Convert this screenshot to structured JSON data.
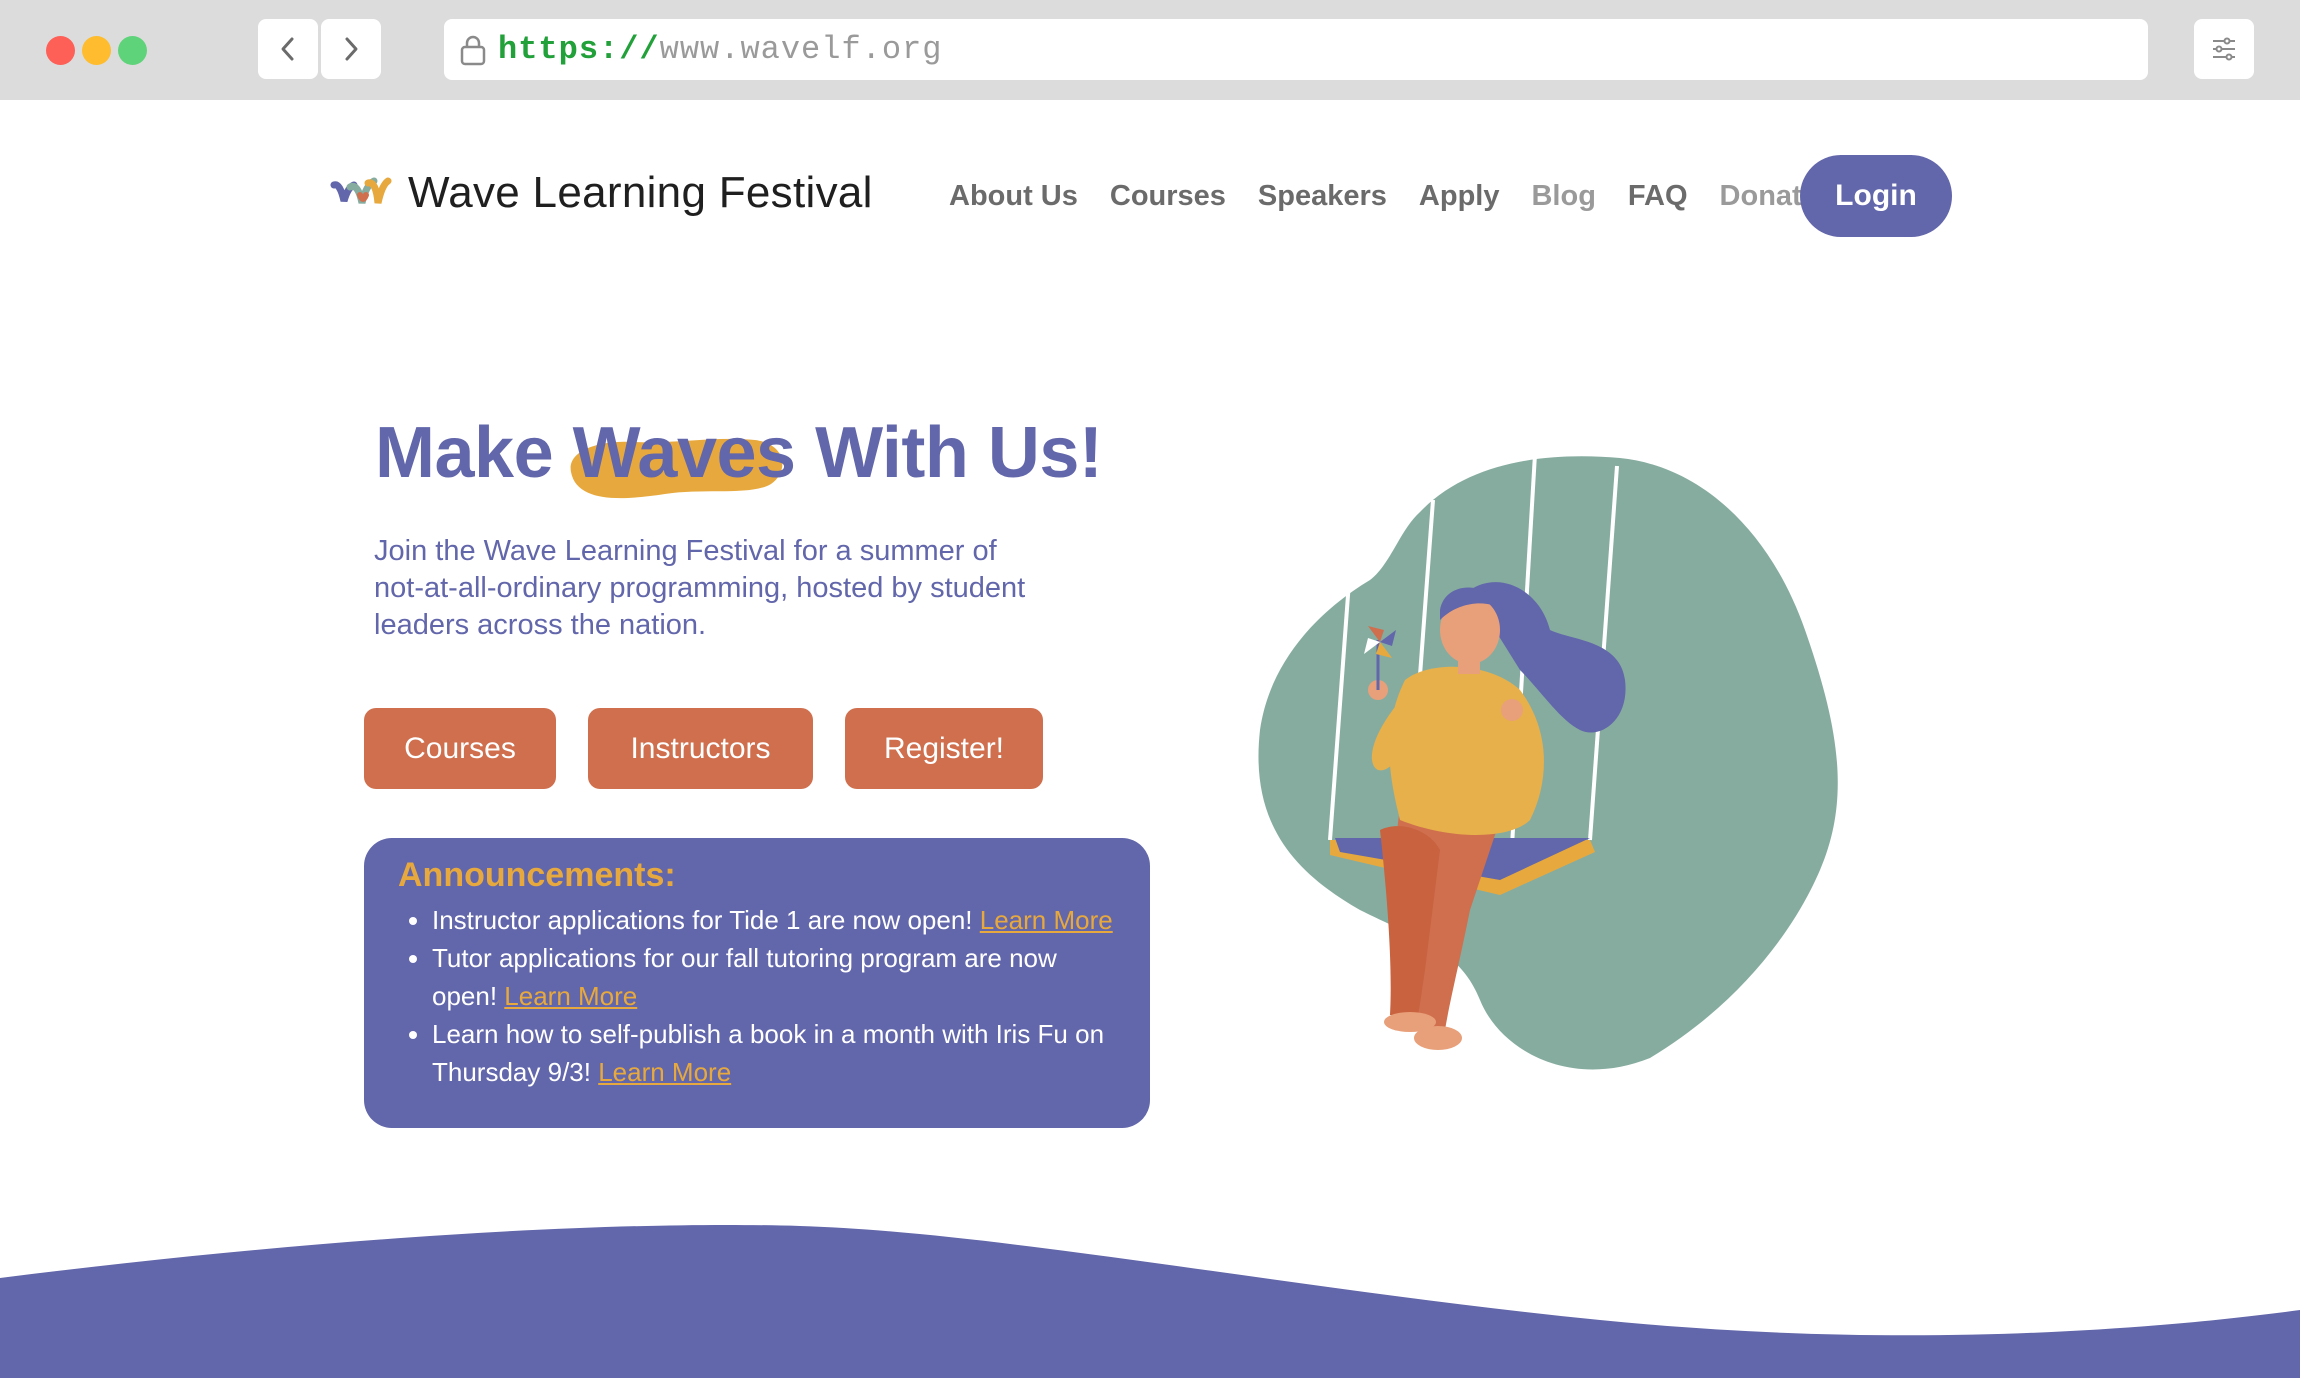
{
  "browser": {
    "url_protocol": "https://",
    "url_host": "www.wavelf.org"
  },
  "header": {
    "site_name": "Wave Learning Festival",
    "nav": [
      "About Us",
      "Courses",
      "Speakers",
      "Apply",
      "Blog",
      "FAQ",
      "Donate"
    ],
    "login_label": "Login"
  },
  "hero": {
    "title_part1": "Make ",
    "title_highlight": "Waves",
    "title_part2": " With Us!",
    "subtitle": "Join the Wave Learning Festival for a summer of not-at-all-ordinary programming, hosted by student leaders across the nation.",
    "buttons": [
      "Courses",
      "Instructors",
      "Register!"
    ]
  },
  "announcements": {
    "heading": "Announcements:",
    "items": [
      {
        "text": "Instructor applications for Tide 1 are now open! ",
        "link": "Learn More"
      },
      {
        "text": "Tutor applications for our fall tutoring program are now open! ",
        "link": "Learn More"
      },
      {
        "text": "Learn how to self-publish a book in a month with Iris Fu on Thursday 9/3! ",
        "link": "Learn More"
      }
    ]
  },
  "colors": {
    "primary": "#6266aa",
    "accent": "#e7a93e",
    "button": "#cf6f4e",
    "blob": "#86aca0"
  },
  "icons": {
    "back": "chevron-left-icon",
    "forward": "chevron-right-icon",
    "lock": "lock-icon",
    "settings": "sliders-icon"
  }
}
